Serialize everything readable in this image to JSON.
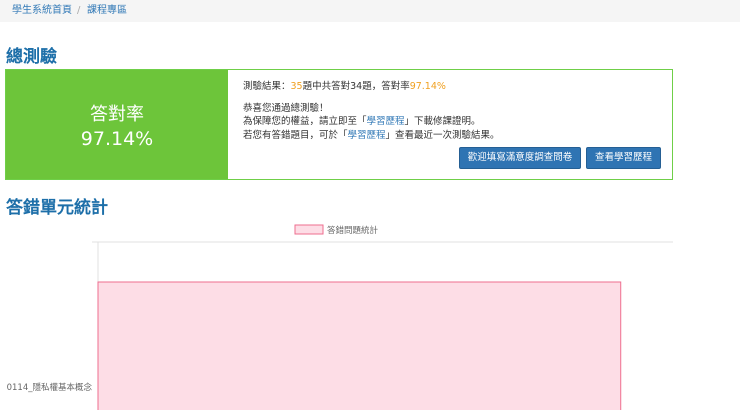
{
  "breadcrumb": {
    "home": "學生系統首頁",
    "separator": "/",
    "current": "課程專區"
  },
  "exam_section_title": "總測驗",
  "score": {
    "label": "答對率",
    "value": "97.14%"
  },
  "result": {
    "prefix": "測驗結果：",
    "total": "35",
    "middle": "題中共答對34題，答對率",
    "rate": "97.14%"
  },
  "messages": {
    "congrats": "恭喜您通過總測驗！",
    "line2_before": "為保障您的權益，請立即至「",
    "line2_link": "學習歷程",
    "line2_after": "」下載修課證明。",
    "line3_before": "若您有答錯題目，可於「",
    "line3_link": "學習歷程",
    "line3_after": "」查看最近一次測驗結果。"
  },
  "buttons": {
    "survey": "歡迎填寫滿意度調查問卷",
    "history": "查看學習歷程"
  },
  "stats_section_title": "答錯單元統計",
  "colors": {
    "accent_green": "#6dc53a",
    "link_blue": "#337ab7",
    "highlight_orange": "#f0a020",
    "button_blue": "#2f74b3"
  },
  "chart_data": {
    "type": "bar",
    "orientation": "horizontal",
    "legend": [
      "答錯問題統計"
    ],
    "legend_position": "top-center",
    "categories": [
      "0114_隱私權基本概念"
    ],
    "series": [
      {
        "name": "答錯問題統計",
        "values": [
          1
        ]
      }
    ],
    "bar_color": "#fddde6",
    "bar_border_color": "#ee6e8f",
    "xlim": [
      0,
      1.1
    ],
    "grid": true
  }
}
